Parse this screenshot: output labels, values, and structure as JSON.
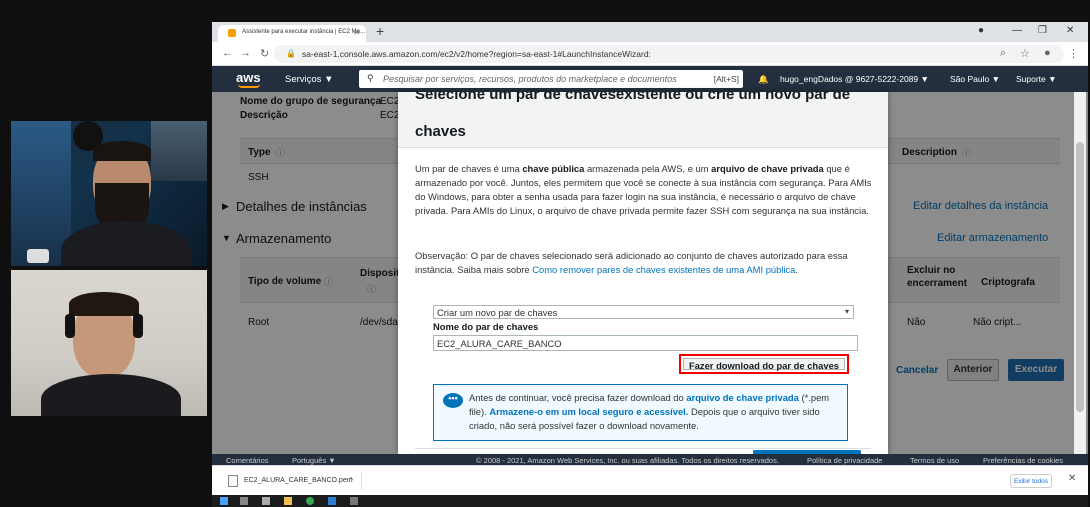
{
  "browser": {
    "tab_title": "Assistente para executar instância | EC2 Ma...",
    "url": "sa-east-1.console.aws.amazon.com/ec2/v2/home?region=sa-east-1#LaunchInstanceWizard:"
  },
  "aws_header": {
    "logo": "aws",
    "services": "Serviços ▼",
    "search_placeholder": "Pesquisar por serviços, recursos, produtos do marketplace e documentos",
    "search_shortcut": "[Alt+S]",
    "account": "hugo_engDados @ 9627-5222-2089 ▼",
    "region": "São Paulo ▼",
    "support": "Suporte ▼"
  },
  "page": {
    "sg_name_label": "Nome do grupo de segurança",
    "sg_name_value": "EC2",
    "description_label": "Descrição",
    "description_value": "EC2",
    "type_header": "Type",
    "description_header": "Description",
    "type_value": "SSH",
    "instance_details": "Detalhes de instâncias",
    "edit_instance_details": "Editar detalhes da instância",
    "storage": "Armazenamento",
    "edit_storage": "Editar armazenamento",
    "volume_type_header": "Tipo de volume",
    "device_header": "Disposit",
    "delete_on_term_header_1": "Excluir no",
    "delete_on_term_header_2": "encerrament",
    "encryption_header": "Criptografa",
    "root": "Root",
    "device": "/dev/sda",
    "delete_value": "Não",
    "encryption_value": "Não cript...",
    "cancel": "Cancelar",
    "previous": "Anterior",
    "launch": "Executar"
  },
  "modal": {
    "title_line1": "Selecione um par de chavesexistente ou crie um novo par de",
    "title_line2": "chaves",
    "p1_a": "Um par de chaves é uma ",
    "p1_b": "chave pública",
    "p1_c": " armazenada pela AWS, e um ",
    "p1_d": "arquivo de chave privada",
    "p1_e": " que é armazenado por você. Juntos, eles permitem que você se conecte à sua instância com segurança. Para AMIs do Windows, para obter a senha usada para fazer login na sua instância, é necessário o arquivo de chave privada. Para AMIs do Linux, o arquivo de chave privada permite fazer SSH com segurança na sua instância.",
    "p2_text": "Observação: O par de chaves selecionado será adicionado ao conjunto de chaves autorizado para essa instância. Saiba mais sobre ",
    "p2_link": "Como remover pares de chaves existentes de uma AMI pública",
    "p2_end": ".",
    "select_value": "Criar um novo par de chaves",
    "field_label": "Nome do par de chaves",
    "field_value": "EC2_ALURA_CARE_BANCO",
    "download_button": "Fazer download do par de chaves",
    "info_a": "Antes de continuar, você precisa fazer download do ",
    "info_b": "arquivo de chave privada",
    "info_c": " (*.pem file). ",
    "info_d": "Armazene-o em um local seguro e acessível.",
    "info_e": " Depois que o arquivo tiver sido criado, não será possível fazer o download novamente."
  },
  "footer": {
    "comments": "Comentários",
    "language": "Português ▼",
    "copyright": "© 2008 - 2021, Amazon Web Services, Inc. ou suas afiliadas. Todos os direitos reservados.",
    "privacy": "Política de privacidade",
    "terms": "Termos de uso",
    "cookies": "Preferências de cookies"
  },
  "download_bar": {
    "file_name": "EC2_ALURA_CARE_BANCO.pem",
    "show_all": "Exibir todos"
  }
}
